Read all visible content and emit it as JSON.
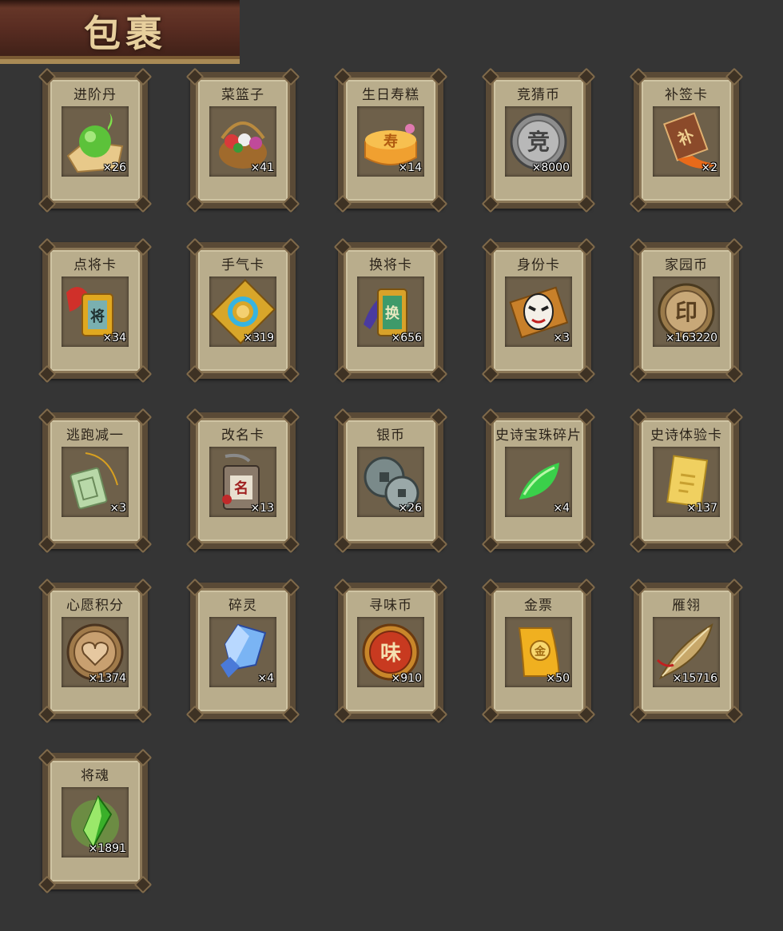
{
  "title": "包裹",
  "items": [
    {
      "name": "进阶丹",
      "qty": "×26",
      "icon": "green-orb-icon"
    },
    {
      "name": "菜篮子",
      "qty": "×41",
      "icon": "flower-basket-icon"
    },
    {
      "name": "生日寿糕",
      "qty": "×14",
      "icon": "birthday-cake-icon"
    },
    {
      "name": "竞猜币",
      "qty": "×8000",
      "icon": "silver-coin-icon"
    },
    {
      "name": "补签卡",
      "qty": "×2",
      "icon": "sign-card-icon"
    },
    {
      "name": "点将卡",
      "qty": "×34",
      "icon": "general-token-icon"
    },
    {
      "name": "手气卡",
      "qty": "×319",
      "icon": "luck-card-icon"
    },
    {
      "name": "换将卡",
      "qty": "×656",
      "icon": "swap-token-icon"
    },
    {
      "name": "身份卡",
      "qty": "×3",
      "icon": "opera-mask-icon"
    },
    {
      "name": "家园币",
      "qty": "×163220",
      "icon": "bronze-coin-icon"
    },
    {
      "name": "逃跑减一",
      "qty": "×3",
      "icon": "jade-tag-icon"
    },
    {
      "name": "改名卡",
      "qty": "×13",
      "icon": "rename-tag-icon"
    },
    {
      "name": "银币",
      "qty": "×26",
      "icon": "ancient-coins-icon"
    },
    {
      "name": "史诗宝珠碎片",
      "qty": "×4",
      "icon": "green-shard-icon"
    },
    {
      "name": "史诗体验卡",
      "qty": "×137",
      "icon": "gold-card-icon"
    },
    {
      "name": "心愿积分",
      "qty": "×1374",
      "icon": "heart-coin-icon"
    },
    {
      "name": "碎灵",
      "qty": "×4",
      "icon": "blue-crystal-icon"
    },
    {
      "name": "寻味币",
      "qty": "×910",
      "icon": "copper-coin-icon"
    },
    {
      "name": "金票",
      "qty": "×50",
      "icon": "gold-scroll-icon"
    },
    {
      "name": "雁翎",
      "qty": "×15716",
      "icon": "feather-icon"
    },
    {
      "name": "将魂",
      "qty": "×1891",
      "icon": "green-spirit-icon"
    }
  ],
  "glyphs": {
    "silver-coin-icon": "竞",
    "bronze-coin-icon": "印",
    "copper-coin-icon": "味",
    "rename-tag-icon": "名",
    "swap-token-icon": "换",
    "general-token-icon": "将",
    "gold-scroll-icon": "金",
    "birthday-cake-icon": "寿",
    "sign-card-icon": "补"
  },
  "colors": {
    "background": "#353535",
    "card": "#b9ad8c",
    "card_border": "#5a4a36",
    "slot": "#6e604a",
    "title": "#e7cf9d"
  }
}
